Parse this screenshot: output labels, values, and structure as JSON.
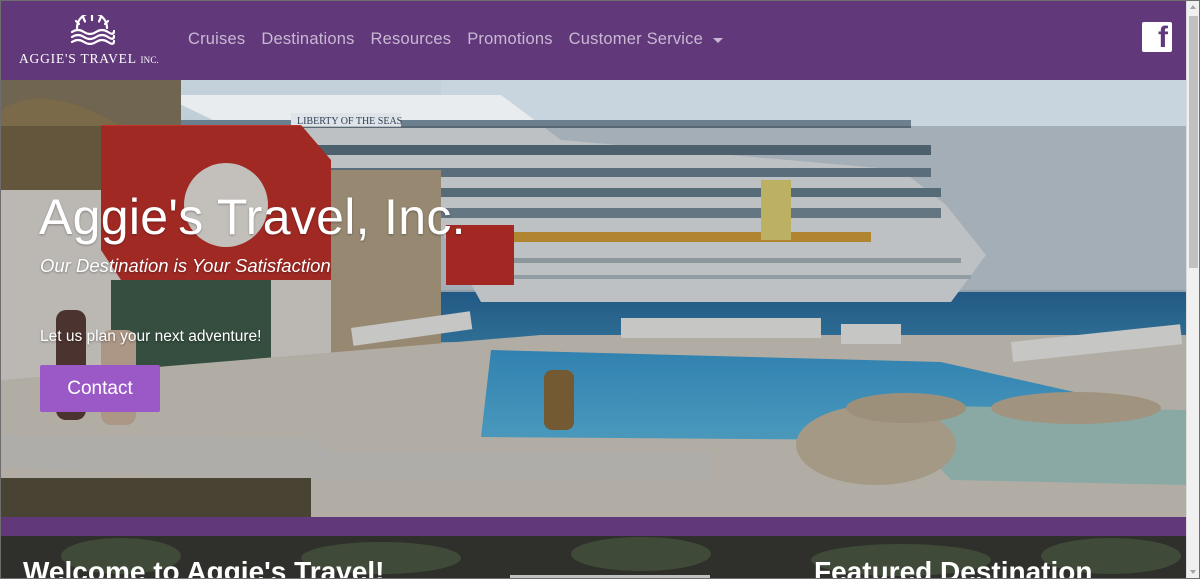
{
  "brand": {
    "name": "AGGIE'S TRAVEL",
    "suffix": "INC."
  },
  "nav": {
    "items": [
      {
        "label": "Cruises"
      },
      {
        "label": "Destinations"
      },
      {
        "label": "Resources"
      },
      {
        "label": "Promotions"
      },
      {
        "label": "Customer Service"
      }
    ]
  },
  "social": {
    "facebook_icon": "facebook-icon",
    "facebook_glyph": "f"
  },
  "hero": {
    "title": "Aggie's Travel, Inc.",
    "tagline": "Our Destination is Your Satisfaction",
    "cta_text": "Let us plan your next adventure!",
    "button_label": "Contact",
    "ship_name": "LIBERTY OF THE SEAS"
  },
  "sections": {
    "welcome_heading": "Welcome to Aggie's Travel!",
    "featured_heading": "Featured Destination"
  },
  "colors": {
    "brand_purple": "#613879",
    "button_purple": "#9b59c7",
    "nav_text": "#c8b8d4"
  }
}
